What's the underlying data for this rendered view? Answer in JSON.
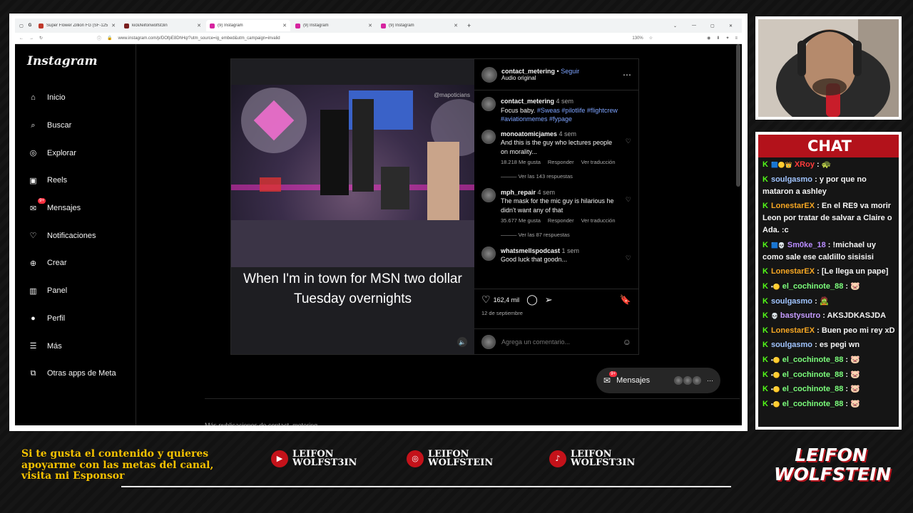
{
  "browser": {
    "tabs": [
      {
        "title": "Super Flower Zillion FG (SF-125",
        "active": false,
        "color": "#c0392b"
      },
      {
        "title": "kick/leifonwolfst3in",
        "active": false,
        "color": "#7a1f1f"
      },
      {
        "title": "(9) Instagram",
        "active": true,
        "color": "#d6249f"
      },
      {
        "title": "(9) Instagram",
        "active": false,
        "color": "#d6249f"
      },
      {
        "title": "(9) Instagram",
        "active": false,
        "color": "#d6249f"
      }
    ],
    "url": "www.instagram.com/p/DOfpE8DhHq/?utm_source=ig_embed&utm_campaign=invalid",
    "zoom": "130%"
  },
  "instagram": {
    "logo": "Instagram",
    "nav": [
      {
        "label": "Inicio",
        "icon": "home-icon"
      },
      {
        "label": "Buscar",
        "icon": "search-icon"
      },
      {
        "label": "Explorar",
        "icon": "compass-icon"
      },
      {
        "label": "Reels",
        "icon": "reels-icon"
      },
      {
        "label": "Mensajes",
        "icon": "messenger-icon",
        "badge": "9+"
      },
      {
        "label": "Notificaciones",
        "icon": "heart-icon"
      },
      {
        "label": "Crear",
        "icon": "plus-icon"
      },
      {
        "label": "Panel",
        "icon": "chart-icon"
      },
      {
        "label": "Perfil",
        "icon": "profile-icon"
      },
      {
        "label": "Más",
        "icon": "menu-icon"
      },
      {
        "label": "Otras apps de Meta",
        "icon": "apps-icon"
      }
    ],
    "post": {
      "author": "contact_metering",
      "follow": "Seguir",
      "audio": "Audio original",
      "video_caption": "When I'm in town for MSN two dollar Tuesday overnights",
      "watermark": "@mapoticians",
      "caption": {
        "user": "contact_metering",
        "time": "4 sem",
        "text": "Focus baby.",
        "tags": "#Sweas #pilotlife #flightcrew #aviationmemes #fypage"
      },
      "comments": [
        {
          "user": "monoatomicjames",
          "time": "4 sem",
          "text": "And this is the guy who lectures people on morality...",
          "likes": "18.218 Me gusta",
          "reply": "Responder",
          "translate": "Ver traducción",
          "replies": "Ver las 143 respuestas"
        },
        {
          "user": "mph_repair",
          "time": "4 sem",
          "text": "The mask for the mic guy is hilarious he didn't want any of that",
          "likes": "35.677 Me gusta",
          "reply": "Responder",
          "translate": "Ver traducción",
          "replies": "Ver las 87 respuestas"
        },
        {
          "user": "whatsmellspodcast",
          "time": "1 sem",
          "text": "Good luck that goodn..."
        }
      ],
      "like_count": "162,4 mil",
      "date": "12 de septiembre",
      "add_comment_placeholder": "Agrega un comentario..."
    },
    "messages_pill": {
      "label": "Mensajes",
      "badge": "9+"
    },
    "more_posts": "Más publicaciones de contact_metering"
  },
  "chat": {
    "title": "CHAT",
    "messages": [
      {
        "user": "XRoy",
        "color": "#ff3b3b",
        "text": "🐢",
        "badges": "🟦🟡👑"
      },
      {
        "user": "soulgasmo",
        "color": "#a0c4ff",
        "text": "y por que no mataron a ashley"
      },
      {
        "user": "LonestarEX",
        "color": "#f5a623",
        "text": "En el RE9 va morir Leon por tratar de salvar a Claire o Ada. :c"
      },
      {
        "user": "Sm0ke_18",
        "color": "#b88cff",
        "text": "!michael uy como sale ese caldillo sisisisi",
        "badges": "🟦💀"
      },
      {
        "user": "LonestarEX",
        "color": "#f5a623",
        "text": "[Le llega un pape]"
      },
      {
        "user": "el_cochinote_88",
        "color": "#7cff7c",
        "text": "🐷",
        "badges": "•🟡"
      },
      {
        "user": "soulgasmo",
        "color": "#a0c4ff",
        "text": "🧟"
      },
      {
        "user": "bastysutro",
        "color": "#c59bff",
        "text": "AKSJDKASJDA",
        "badges": "💀"
      },
      {
        "user": "LonestarEX",
        "color": "#f5a623",
        "text": "Buen peo mi rey xD"
      },
      {
        "user": "soulgasmo",
        "color": "#a0c4ff",
        "text": "es pegi wn"
      },
      {
        "user": "el_cochinote_88",
        "color": "#7cff7c",
        "text": "🐷",
        "badges": "•🟡"
      },
      {
        "user": "el_cochinote_88",
        "color": "#7cff7c",
        "text": "🐷",
        "badges": "•🟡"
      },
      {
        "user": "el_cochinote_88",
        "color": "#7cff7c",
        "text": "🐷",
        "badges": "•🟡"
      },
      {
        "user": "el_cochinote_88",
        "color": "#7cff7c",
        "text": "🐷",
        "badges": "•🟡"
      }
    ]
  },
  "footer": {
    "sponsor": "Si te gusta el contenido y quieres apoyarme con las metas del canal, visita mi Esponsor",
    "socials": [
      {
        "platform": "youtube-icon",
        "line1": "LEIFON",
        "line2": "WOLFST3IN"
      },
      {
        "platform": "instagram-icon",
        "line1": "LEIFON",
        "line2": "WOLFSTEIN"
      },
      {
        "platform": "tiktok-icon",
        "line1": "LEIFON",
        "line2": "WOLFST3IN"
      }
    ],
    "brand_line1": "LEIFON",
    "brand_line2": "WOLFSTEIN"
  },
  "colors": {
    "accent": "#b3121b",
    "ig_link": "#7ea4ff",
    "kick_green": "#53fc18",
    "sponsor_gold": "#f5c200"
  }
}
